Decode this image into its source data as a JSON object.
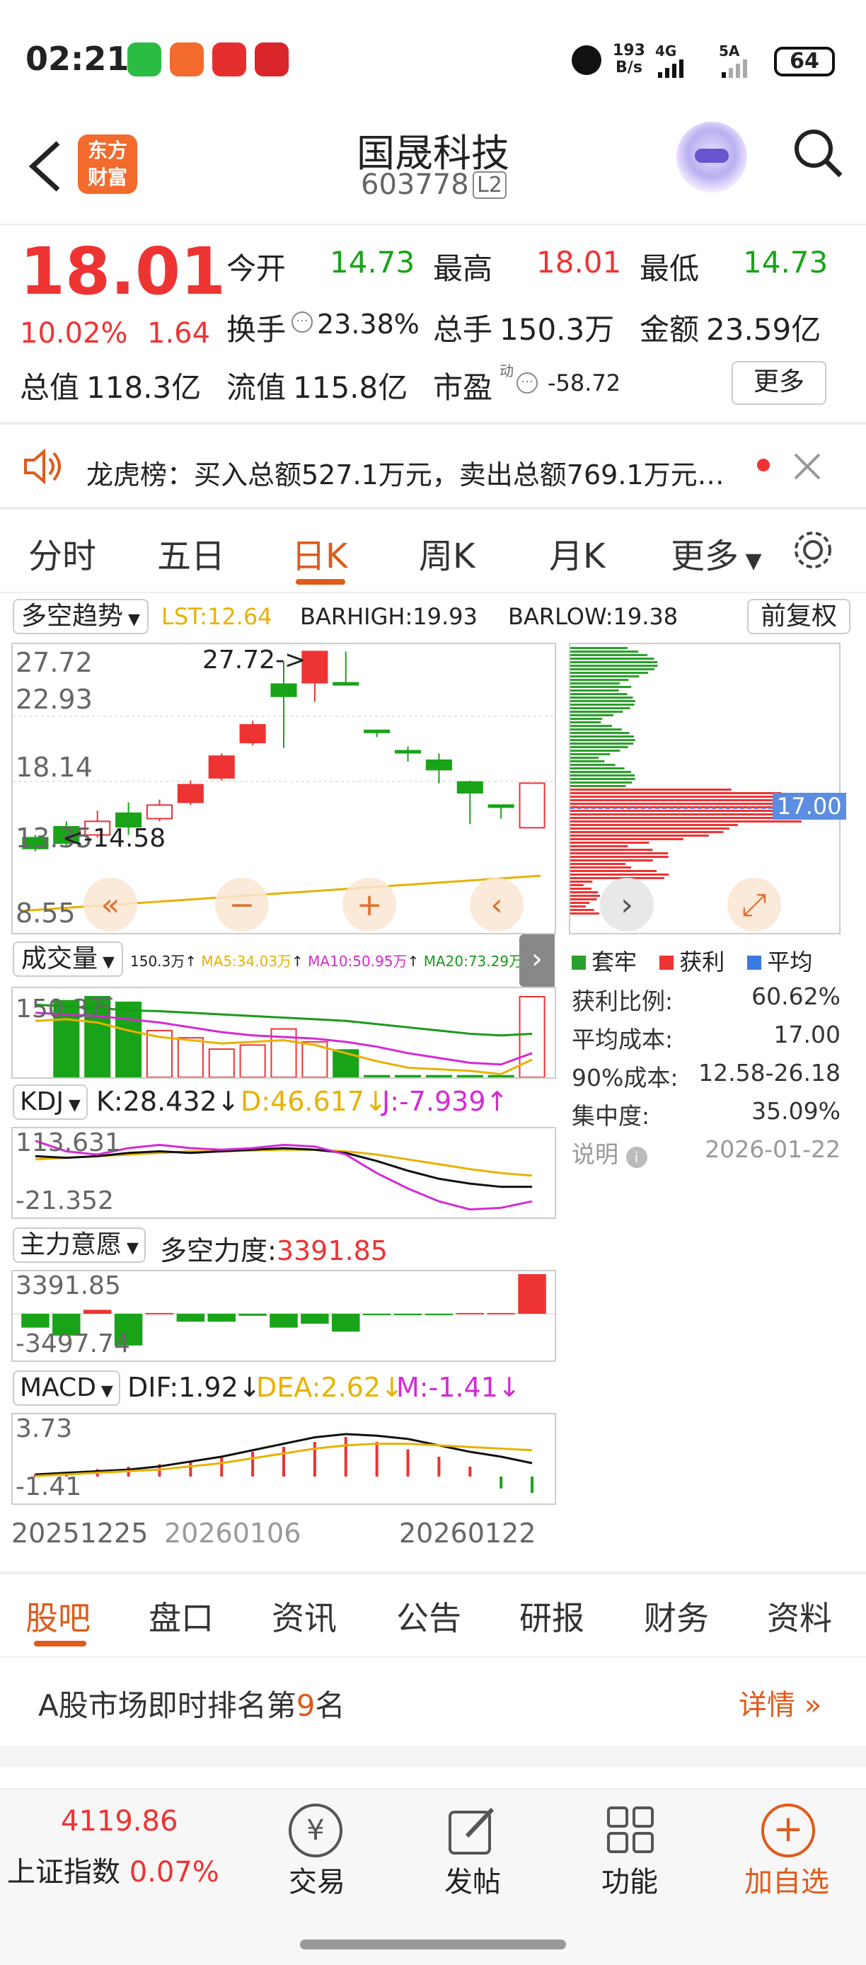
{
  "status_bar": {
    "time": "02:21",
    "net_speed_top": "193",
    "net_speed_bottom": "B/s",
    "net1": "4G",
    "net2": "5A",
    "battery": "64"
  },
  "header": {
    "title": "国晟科技",
    "code": "603778",
    "level": "L2",
    "brand_top": "东方",
    "brand_bottom": "财富"
  },
  "quote": {
    "price": "18.01",
    "change_pct": "10.02%",
    "change": "1.64",
    "open_label": "今开",
    "open": "14.73",
    "high_label": "最高",
    "high": "18.01",
    "low_label": "最低",
    "low": "14.73",
    "turnover_label": "换手",
    "turnover": "23.38%",
    "volume_label": "总手",
    "volume": "150.3万",
    "amount_label": "金额",
    "amount": "23.59亿",
    "total_cap_label": "总值",
    "total_cap": "118.3亿",
    "float_cap_label": "流值",
    "float_cap": "115.8亿",
    "pe_label": "市盈",
    "pe_sup": "动",
    "pe": "-58.72",
    "more": "更多"
  },
  "notice": {
    "text": "龙虎榜：买入总额527.1万元，卖出总额769.1万元…"
  },
  "period_tabs": [
    "分时",
    "五日",
    "日K",
    "周K",
    "月K",
    "更多"
  ],
  "indicator": {
    "name": "多空趋势",
    "lst": "LST:12.64",
    "barhigh": "BARHIGH:19.93",
    "barlow": "BARLOW:19.38",
    "adjust": "前复权"
  },
  "kline": {
    "y_labels": [
      "27.72",
      "22.93",
      "18.14",
      "13.35",
      "8.55"
    ],
    "max_annot": "27.72->",
    "min_annot": "<-14.58",
    "candles": [
      {
        "o": 14.0,
        "c": 13.2,
        "h": 14.2,
        "l": 13.0,
        "up": false
      },
      {
        "o": 13.6,
        "c": 14.8,
        "h": 15.2,
        "l": 13.4,
        "up": false
      },
      {
        "o": 14.2,
        "c": 15.2,
        "h": 16.0,
        "l": 14.0,
        "up": true
      },
      {
        "o": 14.8,
        "c": 15.8,
        "h": 16.6,
        "l": 14.2,
        "up": false
      },
      {
        "o": 15.4,
        "c": 16.4,
        "h": 16.8,
        "l": 15.2,
        "up": true
      },
      {
        "o": 16.6,
        "c": 17.9,
        "h": 18.2,
        "l": 16.4,
        "up": true
      },
      {
        "o": 18.4,
        "c": 20.0,
        "h": 20.2,
        "l": 18.2,
        "up": true
      },
      {
        "o": 21.0,
        "c": 22.3,
        "h": 22.6,
        "l": 20.8,
        "up": true
      },
      {
        "o": 24.4,
        "c": 25.3,
        "h": 27.0,
        "l": 20.6,
        "up": false
      },
      {
        "o": 25.4,
        "c": 27.7,
        "h": 27.72,
        "l": 24.0,
        "up": true
      },
      {
        "o": 25.3,
        "c": 25.4,
        "h": 27.7,
        "l": 25.3,
        "up": false
      },
      {
        "o": 21.9,
        "c": 21.8,
        "h": 21.9,
        "l": 21.4,
        "up": false
      },
      {
        "o": 20.4,
        "c": 20.3,
        "h": 20.7,
        "l": 19.6,
        "up": false
      },
      {
        "o": 19.7,
        "c": 19.0,
        "h": 20.2,
        "l": 18.0,
        "up": false
      },
      {
        "o": 18.1,
        "c": 17.3,
        "h": 18.2,
        "l": 15.0,
        "up": false
      },
      {
        "o": 16.4,
        "c": 16.4,
        "h": 16.4,
        "l": 15.4,
        "up": false
      },
      {
        "o": 14.73,
        "c": 18.01,
        "h": 18.01,
        "l": 14.73,
        "up": true
      }
    ]
  },
  "chips": {
    "price_label": "17.00",
    "legend": [
      "套牢",
      "获利",
      "平均"
    ],
    "stats": [
      {
        "label": "获利比例:",
        "value": "60.62%"
      },
      {
        "label": "平均成本:",
        "value": "17.00"
      },
      {
        "label": "90%成本:",
        "value": "12.58-26.18"
      },
      {
        "label": "集中度:",
        "value": "35.09%"
      }
    ],
    "note": "说明",
    "date": "2026-01-22"
  },
  "volume": {
    "name": "成交量",
    "v": "150.3万",
    "ma5": "MA5:34.03万",
    "ma10": "MA10:50.95万",
    "ma20": "MA20:73.29万",
    "top_label": "150.3万",
    "bars": [
      0,
      0.95,
      1.0,
      0.93,
      0.58,
      0.49,
      0.35,
      0.4,
      0.6,
      0.44,
      0.34,
      0.02,
      0.02,
      0.02,
      0.02,
      0.02,
      1.0
    ],
    "colors": [
      "r",
      "g",
      "g",
      "g",
      "r",
      "r",
      "r",
      "r",
      "r",
      "r",
      "g",
      "g",
      "g",
      "g",
      "g",
      "g",
      "r"
    ]
  },
  "kdj": {
    "name": "KDJ",
    "k": "K:28.432",
    "d": "D:46.617",
    "j": "J:-7.939",
    "top": "113.631",
    "bottom": "-21.352"
  },
  "mfi": {
    "name": "主力意愿",
    "label": "多空力度:",
    "value": "3391.85",
    "top": "3391.85",
    "bottom": "-3497.74",
    "bars": [
      -0.35,
      -0.55,
      0.1,
      -0.8,
      0.02,
      -0.2,
      -0.2,
      -0.05,
      -0.35,
      -0.25,
      -0.45,
      -0.02,
      -0.02,
      -0.02,
      0.02,
      0.02,
      1.0
    ]
  },
  "macd": {
    "name": "MACD",
    "dif": "DIF:1.92",
    "dea": "DEA:2.62",
    "m": "M:-1.41",
    "top": "3.73",
    "bottom": "-1.41",
    "bars": [
      0.05,
      0.1,
      0.15,
      0.2,
      0.25,
      0.3,
      0.4,
      0.5,
      0.6,
      0.7,
      0.8,
      0.7,
      0.55,
      0.4,
      0.2,
      -0.4,
      -0.55
    ]
  },
  "dates": [
    "20251225",
    "20260106",
    "20260122"
  ],
  "bottom_tabs": [
    "股吧",
    "盘口",
    "资讯",
    "公告",
    "研报",
    "财务",
    "资料"
  ],
  "ranking": {
    "prefix": "A股市场即时排名第",
    "rank": "9",
    "suffix": "名",
    "link": "详情"
  },
  "footer": {
    "index_value": "4119.86",
    "index_name": "上证指数",
    "index_change": "0.07%",
    "trade": "交易",
    "post": "发帖",
    "func": "功能",
    "add": "加自选"
  }
}
